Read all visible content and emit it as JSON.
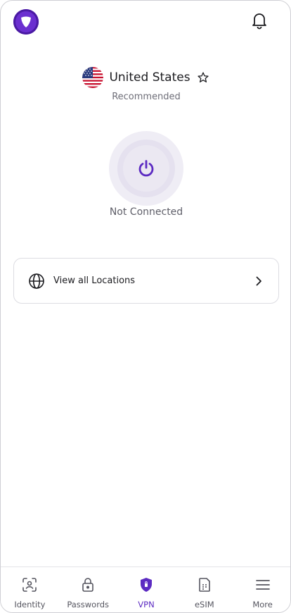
{
  "header": {
    "logo_icon": "shield-logo-icon",
    "notification_icon": "bell-icon"
  },
  "location": {
    "country": "United States",
    "subtitle": "Recommended",
    "flag_icon": "us-flag-icon",
    "favorite_icon": "star-outline-icon"
  },
  "connection": {
    "status": "Not Connected",
    "power_icon": "power-icon",
    "accent_color": "#5c2bc2"
  },
  "locations_card": {
    "label": "View all Locations",
    "icon": "globe-icon",
    "chevron": "chevron-right-icon"
  },
  "bottom_nav": {
    "items": [
      {
        "label": "Identity",
        "icon": "face-scan-icon",
        "active": false
      },
      {
        "label": "Passwords",
        "icon": "lock-icon",
        "active": false
      },
      {
        "label": "VPN",
        "icon": "vpn-shield-icon",
        "active": true
      },
      {
        "label": "eSIM",
        "icon": "sim-card-icon",
        "active": false
      },
      {
        "label": "More",
        "icon": "menu-icon",
        "active": false
      }
    ]
  }
}
